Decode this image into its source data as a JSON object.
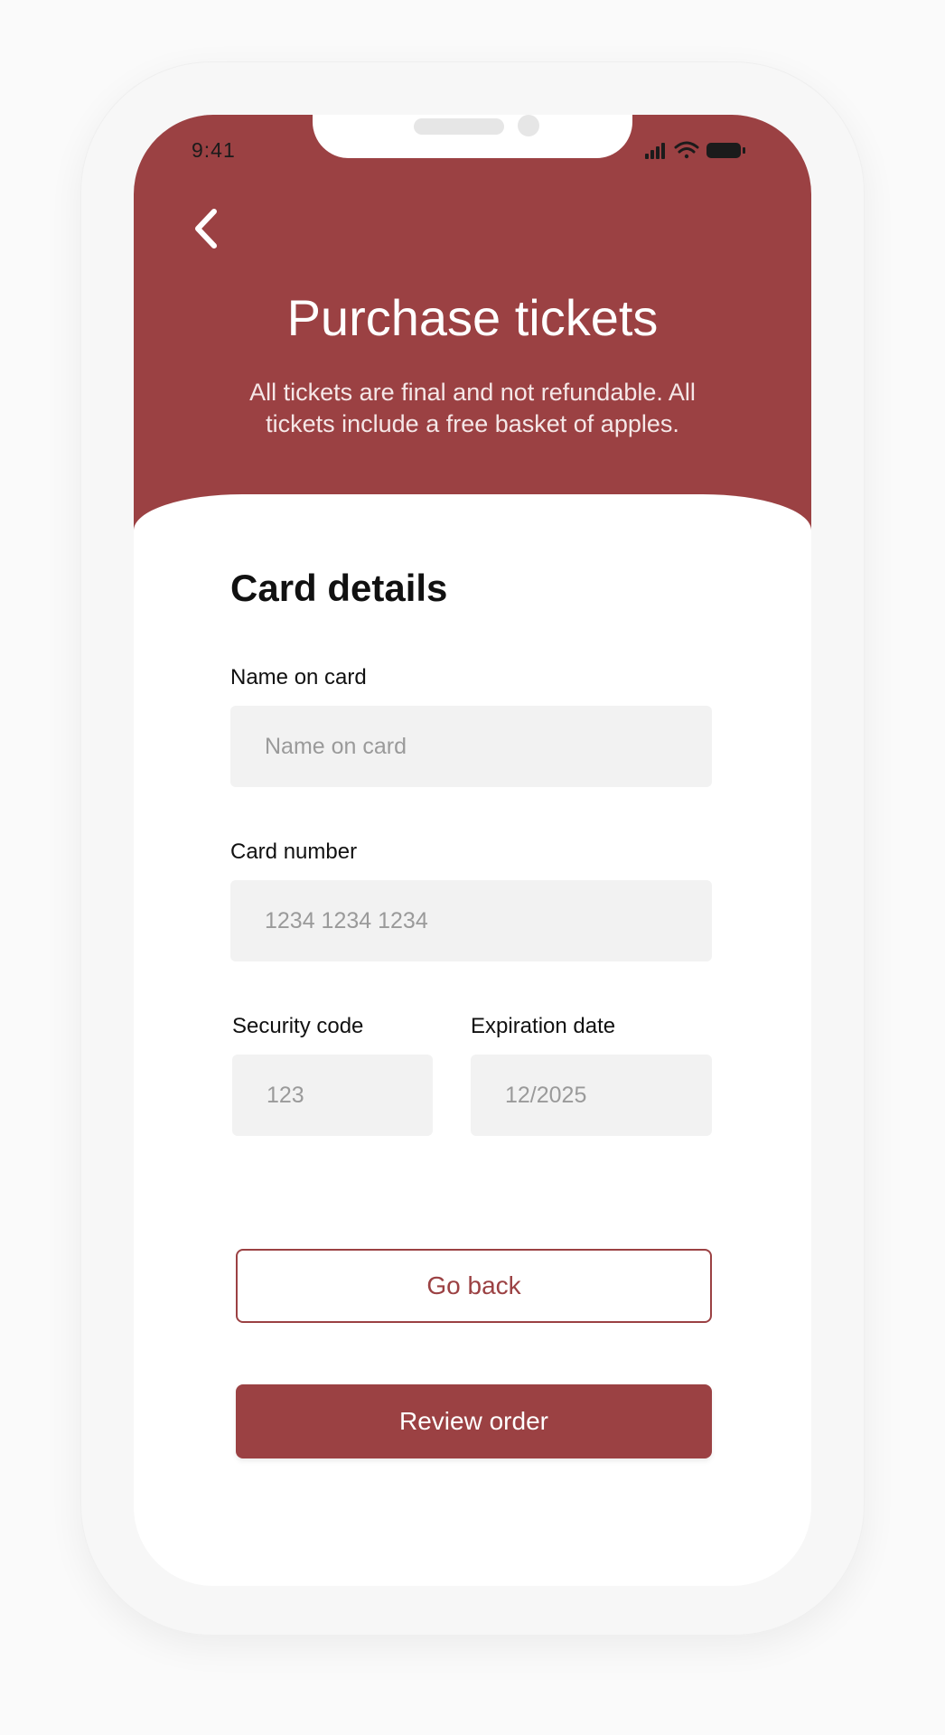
{
  "status_bar": {
    "time": "9:41"
  },
  "header": {
    "title": "Purchase tickets",
    "subtitle": "All tickets are final and not refundable. All tickets include a free basket of apples."
  },
  "form": {
    "section_title": "Card details",
    "name": {
      "label": "Name on card",
      "placeholder": "Name on card"
    },
    "number": {
      "label": "Card number",
      "placeholder": "1234 1234 1234"
    },
    "security": {
      "label": "Security code",
      "placeholder": "123"
    },
    "expiration": {
      "label": "Expiration date",
      "placeholder": "12/2025"
    }
  },
  "buttons": {
    "go_back": "Go back",
    "review": "Review order"
  },
  "colors": {
    "brand": "#9b4143",
    "input_bg": "#f2f2f2"
  },
  "icons": {
    "back": "chevron-left-icon",
    "signal": "cellular-signal-icon",
    "wifi": "wifi-icon",
    "battery": "battery-icon"
  }
}
